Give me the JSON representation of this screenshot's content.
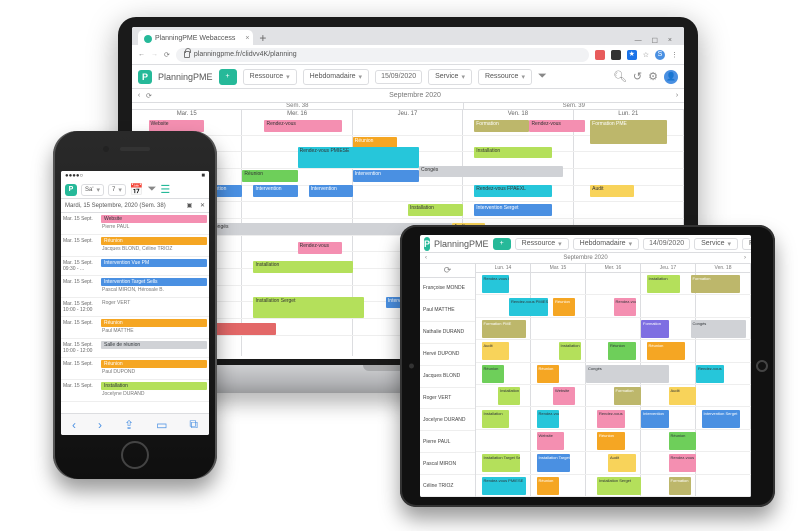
{
  "browser": {
    "tab_title": "PlanningPME Webaccess",
    "url": "planningpme.fr/clidvv4K/planning"
  },
  "laptop": {
    "brand": "PlanningPME",
    "toolbar": {
      "add": "+",
      "resource_label": "Ressource",
      "view_label": "Hebdomadaire",
      "date": "15/09/2020",
      "filter1": "Service",
      "filter2": "Ressource"
    },
    "month_title": "Septembre 2020",
    "week_left": "Sem. 38",
    "week_right": "Sem. 39",
    "days": [
      "Mar. 15",
      "Mer. 16",
      "Jeu. 17",
      "Ven. 18",
      "Lun. 21"
    ],
    "events": {
      "e1": "Rendez-vous",
      "e2": "Réunion",
      "e3": "Formation",
      "e4": "Formation PME",
      "e5": "Réunion",
      "e6": "Rendez-vous PMIESE",
      "e7": "Installation",
      "e8": "Intervention",
      "e9": "Congés",
      "e10": "Audit",
      "e11": "Intervention Serget",
      "e12": "Rendez-vous FPAEXL",
      "e13": "Website",
      "e14": "Installation Serget",
      "e15": "Audit",
      "e16": "Réunion",
      "e17": "Intervention",
      "e18": "Installation",
      "e19": "Congés",
      "e20": "Réunion"
    }
  },
  "phone": {
    "status": {
      "carrier": "●●●●○",
      "time": "",
      "battery": "■"
    },
    "toolbar": {
      "view": "Sa'",
      "count_label": "7"
    },
    "date_title": "Mardi, 15 Septembre, 2020 (Sem. 38)",
    "rows": [
      {
        "time": "Mar. 15 Sept.",
        "ev": "Website",
        "evclass": "pink",
        "sub": "Pierre PAUL"
      },
      {
        "time": "Mar. 15 Sept.",
        "ev": "Réunion",
        "evclass": "orange",
        "sub": "Jacques BLOND, Céline TRIOZ"
      },
      {
        "time": "Mar. 15 Sept. 09:30 - ...",
        "ev": "Intervention Vue PM",
        "evclass": "blue",
        "sub": ""
      },
      {
        "time": "Mar. 15 Sept.",
        "ev": "Intervention Target Sells",
        "evclass": "blue",
        "sub": "Pascal MIRON, Hérosale B."
      },
      {
        "time": "Mar. 15 Sept. 10:00 - 12:00",
        "ev": "",
        "evclass": "",
        "sub": "Roger VERT"
      },
      {
        "time": "Mar. 15 Sept.",
        "ev": "Réunion",
        "evclass": "orange",
        "sub": "Paul MATTHE"
      },
      {
        "time": "Mar. 15 Sept. 10:00 - 12:00",
        "ev": "Salle de réunion",
        "evclass": "gray",
        "sub": ""
      },
      {
        "time": "Mar. 15 Sept.",
        "ev": "Réunion",
        "evclass": "orange",
        "sub": "Paul DUPOND"
      },
      {
        "time": "Mar. 15 Sept.",
        "ev": "Installation",
        "evclass": "lime",
        "sub": "Jocelyne DURAND"
      }
    ]
  },
  "tablet": {
    "brand": "PlanningPME",
    "toolbar": {
      "add": "+",
      "resource_label": "Ressource",
      "view_label": "Hebdomadaire",
      "date": "14/09/2020",
      "filter1": "Service",
      "filter2": "Ressource"
    },
    "month_title": "Septembre 2020",
    "days": [
      "Lun. 14",
      "Mar. 15",
      "Mer. 16",
      "Jeu. 17",
      "Ven. 18"
    ],
    "resources": [
      "Françoise MONDE",
      "Paul MATTHE",
      "Nathalie DURAND",
      "Hervé DUPOND",
      "Jacques BLOND",
      "Roger VERT",
      "Jocelyne DURAND",
      "Pierre PAUL",
      "Pascal MIRON",
      "Céline TRIOZ"
    ],
    "events": {
      "t1": "Installation",
      "t2": "Formation",
      "t3": "Rendez-vous PMIESE",
      "t4": "Réunion",
      "t5": "Formation PME",
      "t6": "Audit",
      "t7": "Congés",
      "t8": "Intervention",
      "t9": "Website",
      "t10": "Audit",
      "t11": "Installation Target Sells",
      "t12": "Installation Serget",
      "t13": "Intervention Serget",
      "t14": "Rendez-vous",
      "t15": "Réunion",
      "t16": "Formation"
    }
  }
}
